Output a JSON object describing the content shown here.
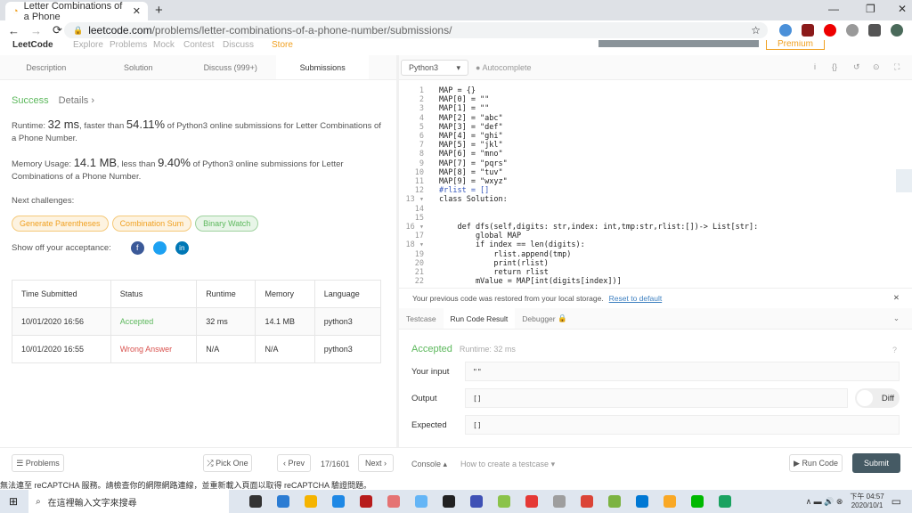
{
  "browser": {
    "tab_title": "Letter Combinations of a Phone",
    "url_domain": "leetcode.com",
    "url_path": "/problems/letter-combinations-of-a-phone-number/submissions/"
  },
  "site_nav": {
    "logo": "LeetCode",
    "items": [
      "Explore",
      "Problems",
      "Mock",
      "Contest",
      "Discuss",
      "Store"
    ],
    "premium": "Premium"
  },
  "problem_tabs": [
    "Description",
    "Solution",
    "Discuss (999+)",
    "Submissions"
  ],
  "editor_header": {
    "language": "Python3",
    "autocomplete": "Autocomplete"
  },
  "result": {
    "status": "Success",
    "details": "Details ›",
    "runtime_pre": "Runtime: ",
    "runtime_val": "32 ms",
    "runtime_mid": ", faster than ",
    "runtime_pct": "54.11%",
    "runtime_post": " of Python3 online submissions for Letter Combinations of a Phone Number.",
    "mem_pre": "Memory Usage: ",
    "mem_val": "14.1 MB",
    "mem_mid": ", less than ",
    "mem_pct": "9.40%",
    "mem_post": " of Python3 online submissions for Letter Combinations of a Phone Number.",
    "next_label": "Next challenges:",
    "challenges": [
      "Generate Parentheses",
      "Combination Sum",
      "Binary Watch"
    ],
    "share_label": "Show off your acceptance:"
  },
  "submissions": {
    "headers": [
      "Time Submitted",
      "Status",
      "Runtime",
      "Memory",
      "Language"
    ],
    "rows": [
      [
        "10/01/2020 16:56",
        "Accepted",
        "32 ms",
        "14.1 MB",
        "python3"
      ],
      [
        "10/01/2020 16:55",
        "Wrong Answer",
        "N/A",
        "N/A",
        "python3"
      ]
    ]
  },
  "code_lines": [
    "MAP = {}",
    "MAP[0] = \"\"",
    "MAP[1] = \"\"",
    "MAP[2] = \"abc\"",
    "MAP[3] = \"def\"",
    "MAP[4] = \"ghi\"",
    "MAP[5] = \"jkl\"",
    "MAP[6] = \"mno\"",
    "MAP[7] = \"pqrs\"",
    "MAP[8] = \"tuv\"",
    "MAP[9] = \"wxyz\"",
    "#rlist = []",
    "class Solution:",
    "",
    "",
    "    def dfs(self,digits: str,index: int,tmp:str,rlist:[])-> List[str]:",
    "        global MAP",
    "        if index == len(digits):",
    "            rlist.append(tmp)",
    "            print(rlist)",
    "            return rlist",
    "        mValue = MAP[int(digits[index])]"
  ],
  "restore": {
    "msg": "Your previous code was restored from your local storage.",
    "link": "Reset to default"
  },
  "console_tabs": [
    "Testcase",
    "Run Code Result",
    "Debugger"
  ],
  "run_result": {
    "status": "Accepted",
    "runtime": "Runtime: 32 ms",
    "input_label": "Your input",
    "input": "\"\"",
    "output_label": "Output",
    "output": "[]",
    "diff": "Diff",
    "expected_label": "Expected",
    "expected": "[]"
  },
  "footer": {
    "problems": "Problems",
    "pick_one": "Pick One",
    "prev": "Prev",
    "page": "17/1601",
    "next": "Next",
    "console": "Console",
    "howto": "How to create a testcase",
    "run": "Run Code",
    "submit": "Submit"
  },
  "recaptcha": "無法連至 reCAPTCHA 服務。請檢查你的網際網路連線，並重新載入頁面以取得 reCAPTCHA 驗證問題。",
  "taskbar": {
    "search": "在這裡輸入文字來搜尋",
    "time": "下午 04:57",
    "date": "2020/10/1"
  },
  "colors": {
    "success": "#5cb85c",
    "wrong": "#d9534f",
    "orange": "#f0a020",
    "submit": "#455a64"
  }
}
